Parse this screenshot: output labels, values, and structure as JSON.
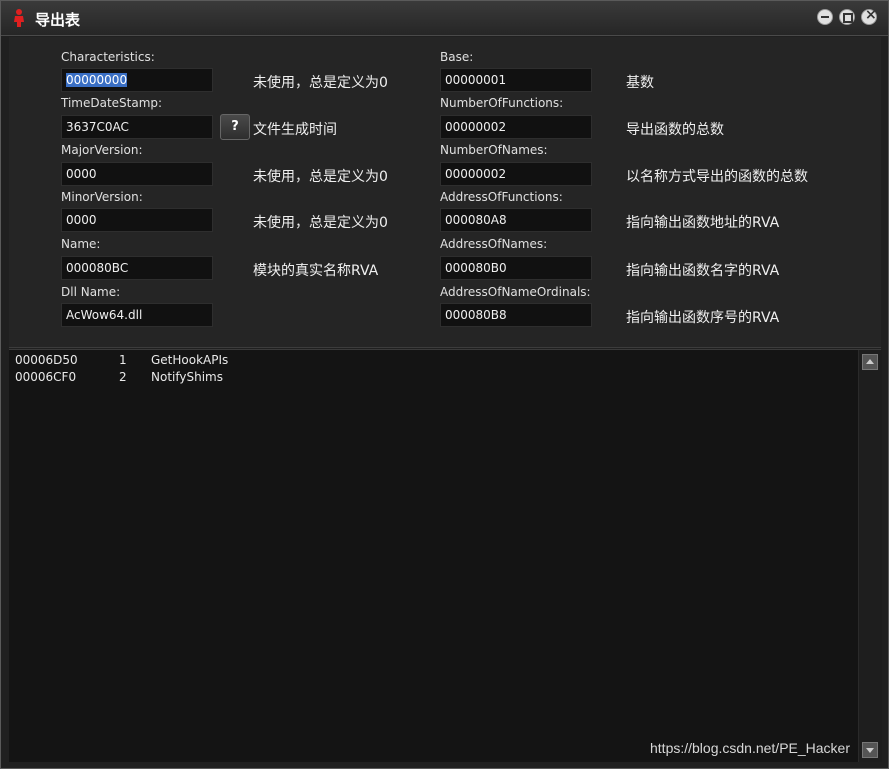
{
  "window": {
    "title": "导出表"
  },
  "form": {
    "left": [
      {
        "label": "Characteristics:",
        "value": "00000000",
        "desc": "未使用，总是定义为0"
      },
      {
        "label": "TimeDateStamp:",
        "value": "3637C0AC",
        "desc": "文件生成时间",
        "button": "?"
      },
      {
        "label": "MajorVersion:",
        "value": "0000",
        "desc": "未使用，总是定义为0"
      },
      {
        "label": "MinorVersion:",
        "value": "0000",
        "desc": "未使用，总是定义为0"
      },
      {
        "label": "Name:",
        "value": "000080BC",
        "desc": "模块的真实名称RVA"
      },
      {
        "label": "Dll Name:",
        "value": "AcWow64.dll",
        "desc": ""
      }
    ],
    "right": [
      {
        "label": "Base:",
        "value": "00000001",
        "desc": "基数"
      },
      {
        "label": "NumberOfFunctions:",
        "value": "00000002",
        "desc": "导出函数的总数"
      },
      {
        "label": "NumberOfNames:",
        "value": "00000002",
        "desc": "以名称方式导出的函数的总数"
      },
      {
        "label": "AddressOfFunctions:",
        "value": "000080A8",
        "desc": "指向输出函数地址的RVA"
      },
      {
        "label": "AddressOfNames:",
        "value": "000080B0",
        "desc": "指向输出函数名字的RVA"
      },
      {
        "label": "AddressOfNameOrdinals:",
        "value": "000080B8",
        "desc": "指向输出函数序号的RVA"
      }
    ]
  },
  "exports": [
    {
      "rva": "00006D50",
      "ordinal": "1",
      "name": "GetHookAPIs"
    },
    {
      "rva": "00006CF0",
      "ordinal": "2",
      "name": "NotifyShims"
    }
  ],
  "watermark": "https://blog.csdn.net/PE_Hacker"
}
